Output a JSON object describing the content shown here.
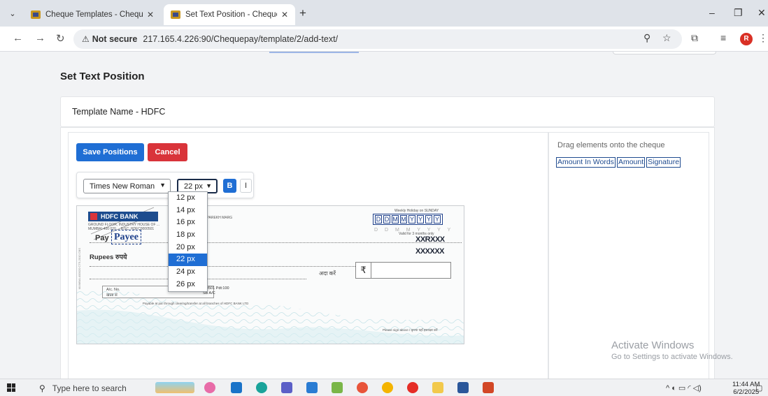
{
  "browser": {
    "tabs": [
      {
        "title": "Cheque Templates - Cheque Pa",
        "active": false
      },
      {
        "title": "Set Text Position - Cheque Pay",
        "active": true
      }
    ],
    "security_label": "Not secure",
    "url": "217.165.4.226:90/Chequepay/template/2/add-text/",
    "profile_initial": "R"
  },
  "page": {
    "title": "Set Text Position",
    "template_name": "Template Name - HDFC",
    "save_label": "Save Positions",
    "cancel_label": "Cancel",
    "font_family": "Times New Roman",
    "font_size": "22 px",
    "bold_label": "B",
    "italic_label": "I",
    "size_options": [
      "12 px",
      "14 px",
      "16 px",
      "18 px",
      "20 px",
      "22 px",
      "24 px",
      "26 px"
    ],
    "selected_size_index": 5,
    "drag_title": "Drag elements onto the cheque",
    "drag_elements": [
      "Amount In Words",
      "Amount",
      "Signature"
    ]
  },
  "cheque": {
    "bank": "HDFC BANK",
    "pay_label": "Pay",
    "payee": "Payee",
    "rupees_label": "Rupees रुपये",
    "ada_label": "अदा करें",
    "rupee_symbol": "₹",
    "date_letters": [
      "D",
      "D",
      "M",
      "M",
      "Y",
      "Y",
      "Y",
      "Y"
    ],
    "date_ghost": "D D M M Y Y Y Y",
    "weekly": "Weekly Holiday on SUNDAY",
    "valid": "Valid for 3 months only",
    "xx1": "XXRXXX",
    "xx2": "XXXXXX",
    "branch": "GROUND FLOOR, INDUSTRY HOUSE OF ... MUMBAI-400 020 ... IFSC: HDFC0000501",
    "payee_name_small": "H Y PAREKH MARG",
    "acno_label": "A/c. No.",
    "acno_sub": "खाता सं",
    "lim_text": "r: 0501 Pdt:100",
    "sb_text": "SB A/C",
    "payable": "Payable at par through clearing/transfer at all branches of HDFC BANK LTD",
    "sign": "Please sign above / कृपया यहाँ हस्ताक्षर करें",
    "side": "MUMBAI-400020 CTS-2010 CBS"
  },
  "watermark": {
    "line1": "Activate Windows",
    "line2": "Go to Settings to activate Windows."
  },
  "taskbar": {
    "search_placeholder": "Type here to search",
    "time": "11:44 AM",
    "date": "6/2/2025"
  },
  "colors": {
    "primary": "#1f6ed4",
    "danger": "#d9343a",
    "link": "#1f4b8f"
  }
}
